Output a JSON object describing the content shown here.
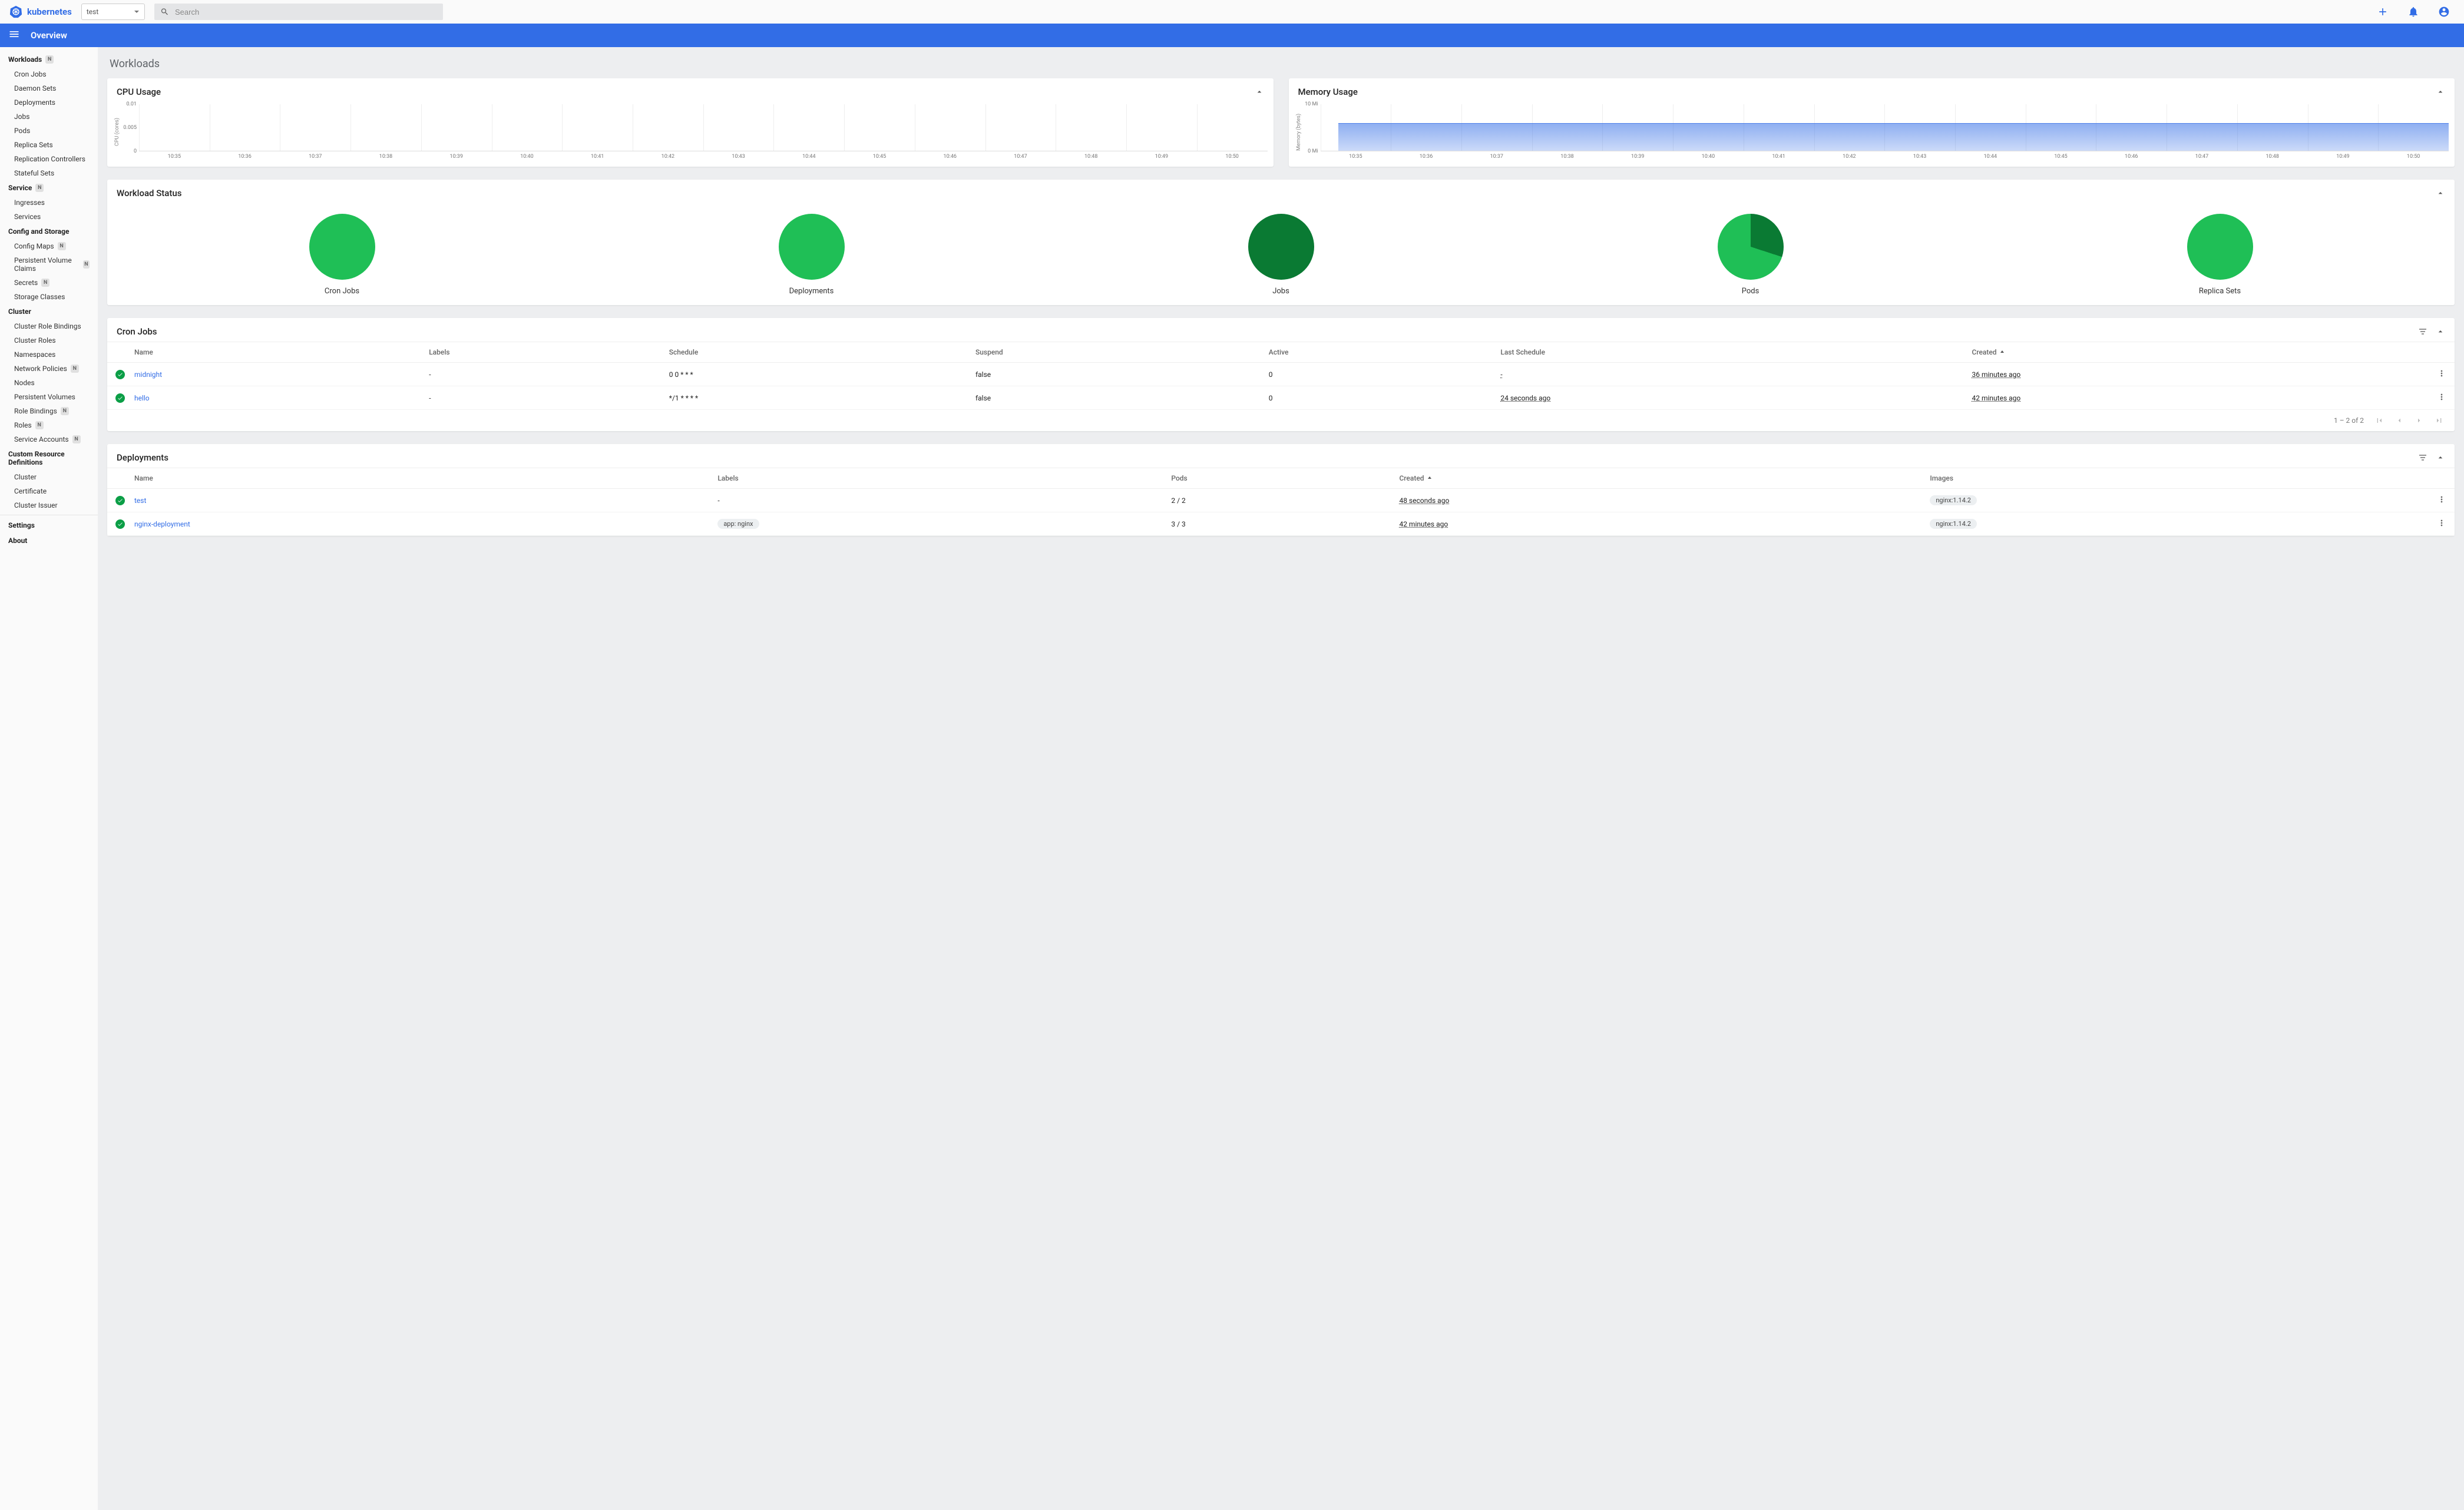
{
  "brand": "kubernetes",
  "namespace_selector": {
    "value": "test"
  },
  "search": {
    "placeholder": "Search"
  },
  "page_header": "Overview",
  "sidebar": {
    "groups": [
      {
        "label": "Workloads",
        "badge": "N",
        "items": [
          {
            "label": "Cron Jobs"
          },
          {
            "label": "Daemon Sets"
          },
          {
            "label": "Deployments"
          },
          {
            "label": "Jobs"
          },
          {
            "label": "Pods"
          },
          {
            "label": "Replica Sets"
          },
          {
            "label": "Replication Controllers"
          },
          {
            "label": "Stateful Sets"
          }
        ]
      },
      {
        "label": "Service",
        "badge": "N",
        "items": [
          {
            "label": "Ingresses"
          },
          {
            "label": "Services"
          }
        ]
      },
      {
        "label": "Config and Storage",
        "items": [
          {
            "label": "Config Maps",
            "badge": "N"
          },
          {
            "label": "Persistent Volume Claims",
            "badge": "N"
          },
          {
            "label": "Secrets",
            "badge": "N"
          },
          {
            "label": "Storage Classes"
          }
        ]
      },
      {
        "label": "Cluster",
        "items": [
          {
            "label": "Cluster Role Bindings"
          },
          {
            "label": "Cluster Roles"
          },
          {
            "label": "Namespaces"
          },
          {
            "label": "Network Policies",
            "badge": "N"
          },
          {
            "label": "Nodes"
          },
          {
            "label": "Persistent Volumes"
          },
          {
            "label": "Role Bindings",
            "badge": "N"
          },
          {
            "label": "Roles",
            "badge": "N"
          },
          {
            "label": "Service Accounts",
            "badge": "N"
          }
        ]
      },
      {
        "label": "Custom Resource Definitions",
        "items": [
          {
            "label": "Cluster"
          },
          {
            "label": "Certificate"
          },
          {
            "label": "Cluster Issuer"
          }
        ]
      }
    ],
    "footer": [
      "Settings",
      "About"
    ]
  },
  "page_title": "Workloads",
  "chart_data": {
    "x_ticks": [
      "10:35",
      "10:36",
      "10:37",
      "10:38",
      "10:39",
      "10:40",
      "10:41",
      "10:42",
      "10:43",
      "10:44",
      "10:45",
      "10:46",
      "10:47",
      "10:48",
      "10:49",
      "10:50"
    ],
    "cpu": {
      "title": "CPU Usage",
      "type": "area",
      "ylabel": "CPU (cores)",
      "y_ticks": [
        "0.01",
        "0.005",
        "0"
      ],
      "series": [
        {
          "name": "cpu",
          "x": [
            "10:35",
            "10:36",
            "10:37",
            "10:38",
            "10:39",
            "10:40",
            "10:41",
            "10:42",
            "10:43",
            "10:44",
            "10:45",
            "10:46",
            "10:47",
            "10:48",
            "10:49",
            "10:50"
          ],
          "values": [
            0,
            0,
            0,
            0,
            0,
            0,
            0,
            0,
            0,
            0,
            0,
            0,
            0,
            0,
            0,
            0
          ]
        }
      ],
      "ylim": [
        0,
        0.01
      ]
    },
    "memory": {
      "title": "Memory Usage",
      "type": "area",
      "ylabel": "Memory (bytes)",
      "y_ticks": [
        "10 Mi",
        "0 Mi"
      ],
      "series": [
        {
          "name": "memory",
          "x": [
            "10:35",
            "10:36",
            "10:37",
            "10:38",
            "10:39",
            "10:40",
            "10:41",
            "10:42",
            "10:43",
            "10:44",
            "10:45",
            "10:46",
            "10:47",
            "10:48",
            "10:49",
            "10:50"
          ],
          "values_mi": [
            6,
            6,
            6,
            6,
            6,
            6,
            6,
            6,
            6,
            6,
            6,
            6,
            6,
            6,
            6,
            6
          ]
        }
      ],
      "ylim_mi": [
        0,
        10
      ]
    }
  },
  "workload_status": {
    "title": "Workload Status",
    "items": [
      {
        "label": "Cron Jobs",
        "colors": [
          "#1fbf56"
        ],
        "fracs": [
          1.0
        ]
      },
      {
        "label": "Deployments",
        "colors": [
          "#1fbf56"
        ],
        "fracs": [
          1.0
        ]
      },
      {
        "label": "Jobs",
        "colors": [
          "#0a7a33"
        ],
        "fracs": [
          1.0
        ]
      },
      {
        "label": "Pods",
        "colors": [
          "#0a7a33",
          "#1fbf56"
        ],
        "fracs": [
          0.3,
          0.7
        ]
      },
      {
        "label": "Replica Sets",
        "colors": [
          "#1fbf56"
        ],
        "fracs": [
          1.0
        ]
      }
    ]
  },
  "cron_jobs": {
    "title": "Cron Jobs",
    "columns": [
      "Name",
      "Labels",
      "Schedule",
      "Suspend",
      "Active",
      "Last Schedule",
      "Created"
    ],
    "rows": [
      {
        "name": "midnight",
        "labels": "-",
        "schedule": "0 0 * * *",
        "suspend": "false",
        "active": "0",
        "last_schedule": "-",
        "created": "36 minutes ago"
      },
      {
        "name": "hello",
        "labels": "-",
        "schedule": "*/1 * * * *",
        "suspend": "false",
        "active": "0",
        "last_schedule": "24 seconds ago",
        "created": "42 minutes ago"
      }
    ],
    "pager": "1 – 2 of 2"
  },
  "deployments": {
    "title": "Deployments",
    "columns": [
      "Name",
      "Labels",
      "Pods",
      "Created",
      "Images"
    ],
    "rows": [
      {
        "name": "test",
        "labels": "-",
        "pods": "2 / 2",
        "created": "48 seconds ago",
        "image": "nginx:1.14.2"
      },
      {
        "name": "nginx-deployment",
        "labels": "app: nginx",
        "pods": "3 / 3",
        "created": "42 minutes ago",
        "image": "nginx:1.14.2"
      }
    ]
  }
}
